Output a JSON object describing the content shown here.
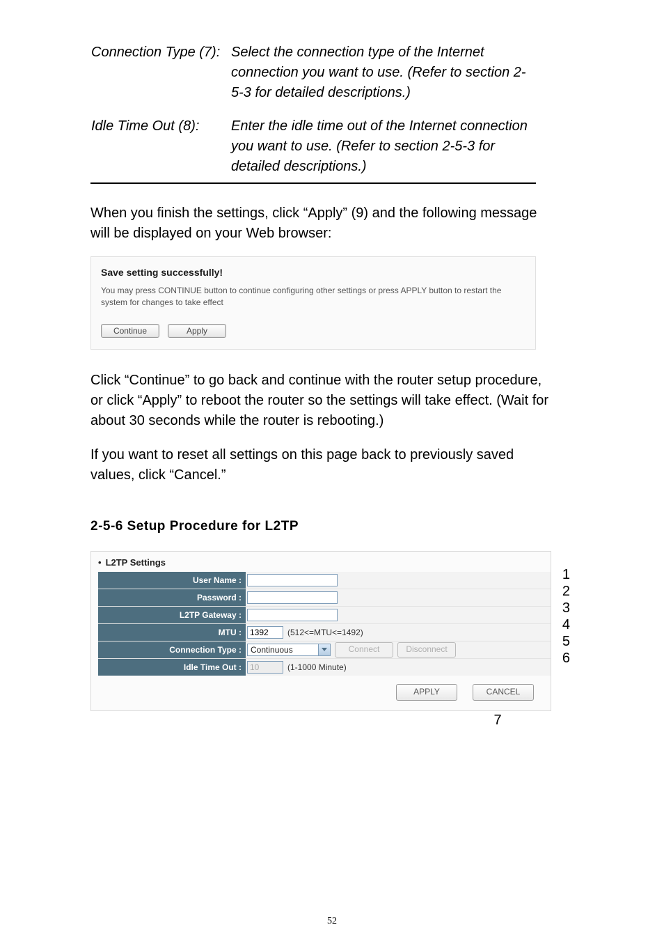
{
  "definitions": [
    {
      "label": "Connection Type (7):",
      "desc": "Select the connection type of the Internet connection you want to use. (Refer to section 2-5-3 for detailed descriptions.)"
    },
    {
      "label": "Idle Time Out (8):",
      "desc": "Enter the idle time out of the Internet connection you want to use. (Refer to section 2-5-3 for detailed descriptions.)"
    }
  ],
  "para1": "When you finish the settings, click “Apply” (9) and the following message will be displayed on your Web browser:",
  "dialog": {
    "title": "Save setting successfully!",
    "text": "You may press CONTINUE button to continue configuring other settings or press APPLY button to restart the system for changes to take effect",
    "continue": "Continue",
    "apply": "Apply"
  },
  "para2": "Click “Continue” to go back and continue with the router setup procedure, or click “Apply” to reboot the router so the settings will take effect. (Wait for about 30 seconds while the router is rebooting.)",
  "para3": "If you want to reset all settings on this page back to previously saved values, click “Cancel.”",
  "section_heading": "2-5-6 Setup Procedure for L2TP",
  "l2tp": {
    "panel_title": "L2TP Settings",
    "rows": {
      "username": {
        "label": "User Name :",
        "value": ""
      },
      "password": {
        "label": "Password :",
        "value": ""
      },
      "gateway": {
        "label": "L2TP Gateway :",
        "value": ""
      },
      "mtu": {
        "label": "MTU :",
        "value": "1392",
        "hint": "(512<=MTU<=1492)"
      },
      "conntype": {
        "label": "Connection Type :",
        "selected": "Continuous",
        "connect": "Connect",
        "disconnect": "Disconnect"
      },
      "idle": {
        "label": "Idle Time Out :",
        "value": "10",
        "hint": "(1-1000 Minute)"
      }
    },
    "apply_btn": "APPLY",
    "cancel_btn": "CANCEL"
  },
  "callouts": {
    "c1": "1",
    "c2": "2",
    "c3": "3",
    "c4": "4",
    "c5": "5",
    "c6": "6",
    "c7": "7"
  },
  "page_number": "52"
}
